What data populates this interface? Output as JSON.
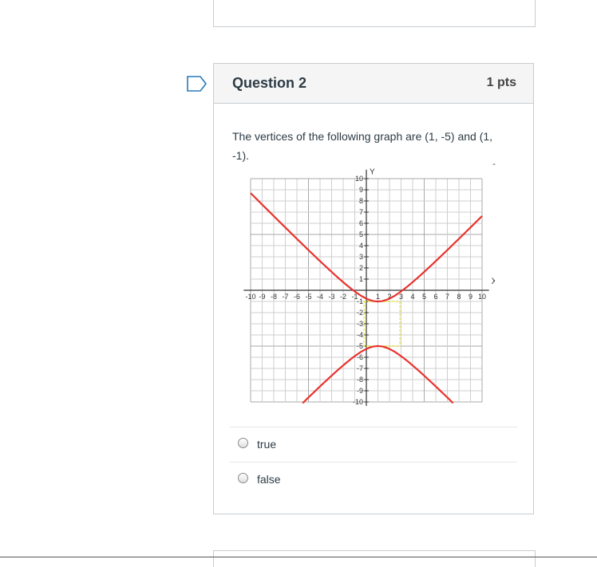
{
  "question": {
    "title": "Question 2",
    "points": "1 pts",
    "text": "The vertices of the following graph are (1, -5) and (1, -1).",
    "stray_mark": "-"
  },
  "graph": {
    "x_axis_label": "X",
    "y_axis_label": "Y",
    "x_ticks": [
      "-10",
      "-9",
      "-8",
      "-7",
      "-6",
      "-5",
      "-4",
      "-3",
      "-2",
      "-1",
      "1",
      "2",
      "3",
      "4",
      "5",
      "6",
      "7",
      "8",
      "9",
      "10"
    ],
    "y_ticks": [
      "10",
      "9",
      "8",
      "7",
      "6",
      "5",
      "4",
      "3",
      "2",
      "1",
      "-1",
      "-2",
      "-3",
      "-4",
      "-5",
      "-6",
      "-7",
      "-8",
      "-9",
      "-10"
    ],
    "curve_color": "#e8322d",
    "box_color": "#e6e62a",
    "grid_color": "#cfcfcf"
  },
  "answers": [
    {
      "label": "true"
    },
    {
      "label": "false"
    }
  ],
  "colors": {
    "flag": "#2a7ab8",
    "border": "#c7cdd1",
    "header_bg": "#f5f5f5"
  }
}
